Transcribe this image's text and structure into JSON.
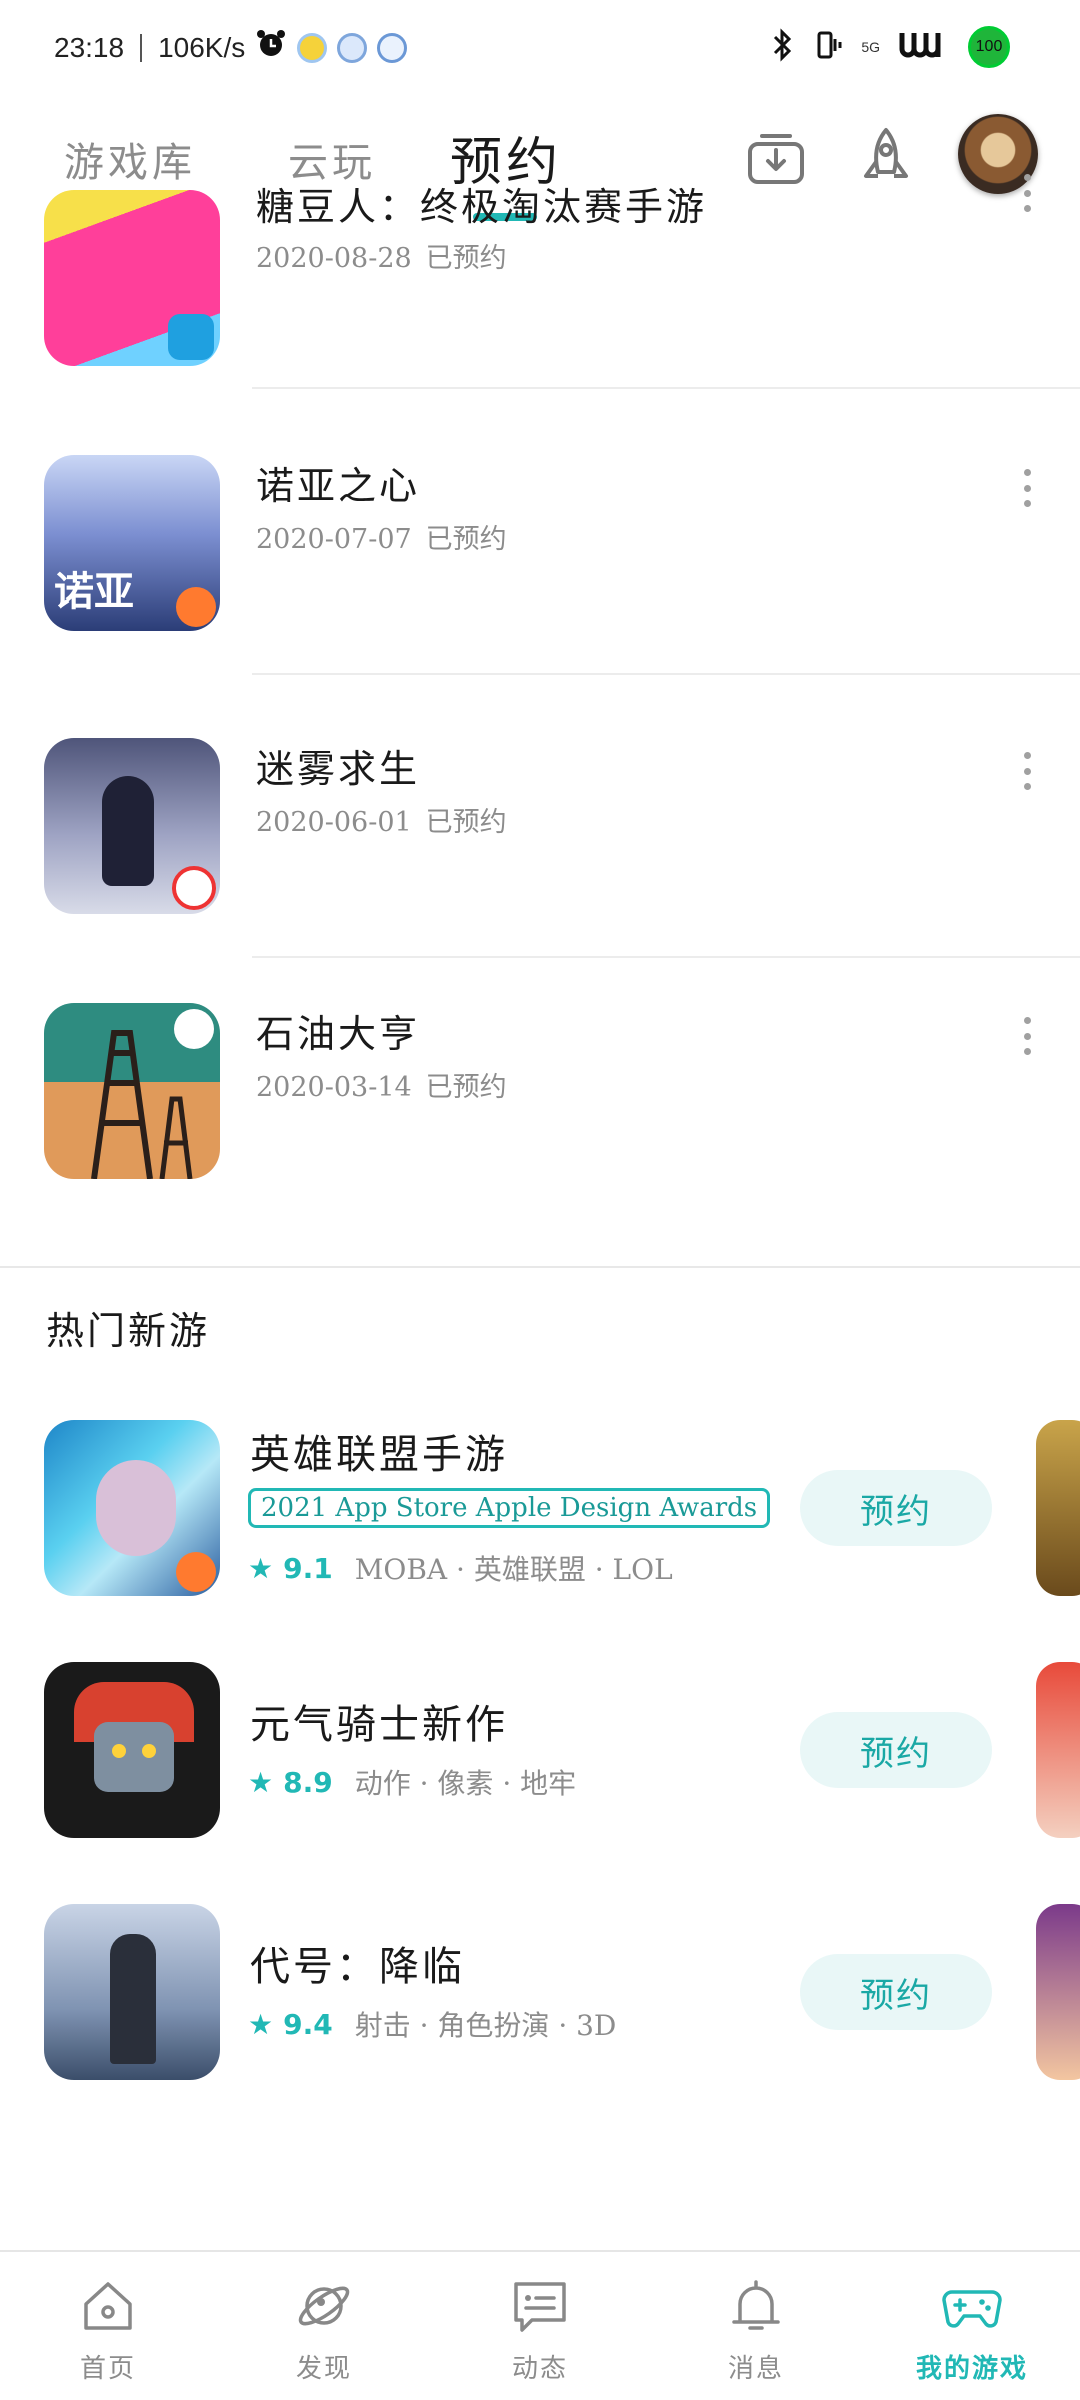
{
  "status_bar": {
    "time": "23:18",
    "speed": "106K/s",
    "battery": "100",
    "signal_text": "5G"
  },
  "header": {
    "tabs": [
      {
        "label": "游戏库"
      },
      {
        "label": "云玩"
      },
      {
        "label": "预约",
        "active": true
      }
    ],
    "icons": [
      "download-icon",
      "rocket-icon"
    ]
  },
  "reserved": {
    "items": [
      {
        "title": "糖豆人：终极淘汰赛手游",
        "date": "2020-08-28",
        "status": "已预约",
        "icon": "fall-guys-icon"
      },
      {
        "title": "诺亚之心",
        "date": "2020-07-07",
        "status": "已预约",
        "icon": "noah-heart-icon"
      },
      {
        "title": "迷雾求生",
        "date": "2020-06-01",
        "status": "已预约",
        "icon": "mist-survival-icon"
      },
      {
        "title": "石油大亨",
        "date": "2020-03-14",
        "status": "已预约",
        "icon": "oil-tycoon-icon"
      }
    ]
  },
  "hot": {
    "section_title": "热门新游",
    "items": [
      {
        "title": "英雄联盟手游",
        "award": "2021 App Store Apple Design Awards",
        "score": "9.1",
        "tags": "MOBA · 英雄联盟 · LOL",
        "button": "预约"
      },
      {
        "title": "元气骑士新作",
        "award": "",
        "score": "8.9",
        "tags": "动作 · 像素 · 地牢",
        "button": "预约"
      },
      {
        "title": "代号：降临",
        "award": "",
        "score": "9.4",
        "tags": "射击 · 角色扮演 · 3D",
        "button": "预约"
      }
    ]
  },
  "nav": {
    "items": [
      {
        "label": "首页",
        "icon": "home-icon"
      },
      {
        "label": "发现",
        "icon": "planet-icon"
      },
      {
        "label": "动态",
        "icon": "chat-icon"
      },
      {
        "label": "消息",
        "icon": "bell-icon"
      },
      {
        "label": "我的游戏",
        "icon": "gamepad-icon",
        "active": true
      }
    ]
  },
  "colors": {
    "accent": "#21b8b5",
    "muted": "#8c8c8c",
    "button_bg": "#e9f7f7"
  }
}
